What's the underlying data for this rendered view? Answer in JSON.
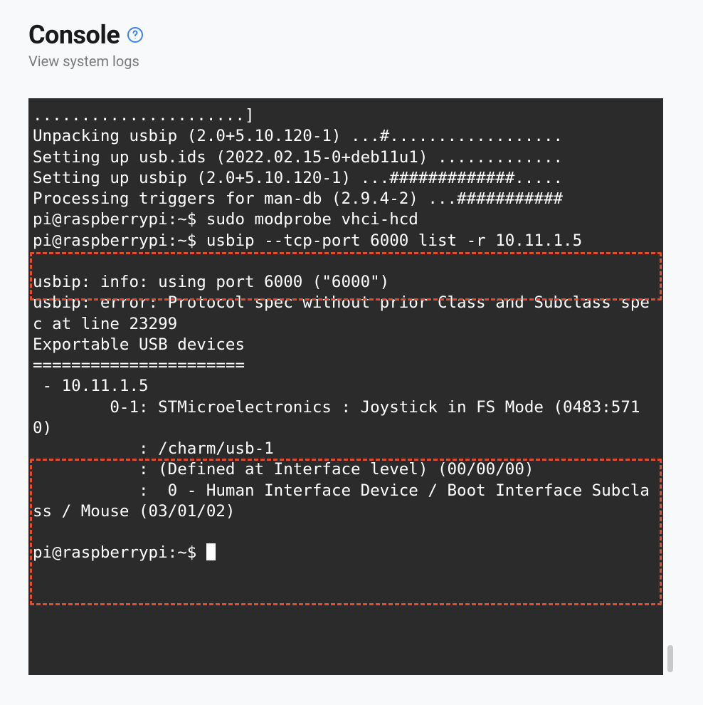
{
  "header": {
    "title": "Console",
    "subtitle": "View system logs"
  },
  "highlight_color": "#e84a2e",
  "console": {
    "lines": [
      "......................]",
      "Unpacking usbip (2.0+5.10.120-1) ...#..................",
      "Setting up usb.ids (2022.02.15-0+deb11u1) .............",
      "Setting up usbip (2.0+5.10.120-1) ...#############.....",
      "Processing triggers for man-db (2.9.4-2) ...###########",
      "pi@raspberrypi:~$ sudo modprobe vhci-hcd",
      "pi@raspberrypi:~$ usbip --tcp-port 6000 list -r 10.11.1.5",
      "",
      "usbip: info: using port 6000 (\"6000\")",
      "usbip: error: Protocol spec without prior Class and Subclass spec at line 23299",
      "Exportable USB devices",
      "======================",
      " - 10.11.1.5",
      "        0-1: STMicroelectronics : Joystick in FS Mode (0483:5710)",
      "           : /charm/usb-1",
      "           : (Defined at Interface level) (00/00/00)",
      "           :  0 - Human Interface Device / Boot Interface Subclass / Mouse (03/01/02)",
      "",
      "pi@raspberrypi:~$ "
    ],
    "prompt": "pi@raspberrypi:~$"
  }
}
